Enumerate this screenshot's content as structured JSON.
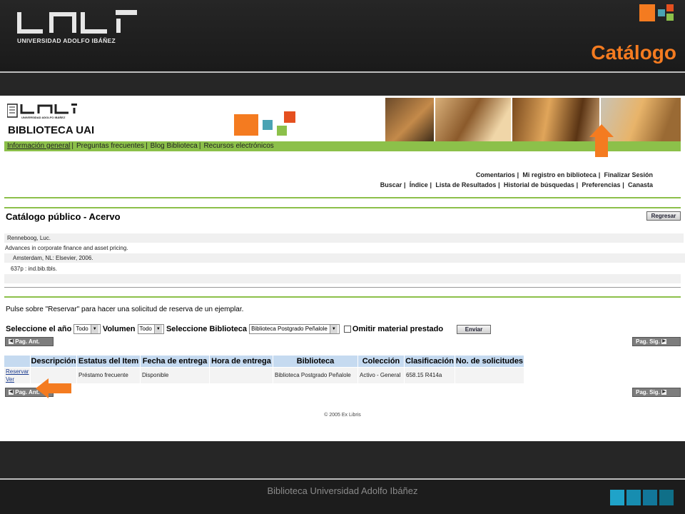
{
  "slide": {
    "logo_text": "UNIVERSIDAD ADOLFO IBÁÑEZ",
    "title": "Catálogo",
    "footer": "Biblioteca Universidad Adolfo Ibáñez",
    "colors": {
      "accent": "#f47b20",
      "green": "#8cc04a",
      "teal": "#0f6f88"
    }
  },
  "webpage": {
    "logo_small_text": "UNIVERSIDAD ADOLFO IBÁÑEZ",
    "library_title": "BIBLIOTECA UAI",
    "top_menu": [
      "Información general",
      "Preguntas frecuentes",
      "Blog Biblioteca",
      "Recursos electrónicos"
    ],
    "user_nav": [
      "Comentarios",
      "Mi registro en biblioteca",
      "Finalizar Sesión"
    ],
    "main_nav": [
      "Buscar",
      "Índice",
      "Lista de Resultados",
      "Historial de búsquedas",
      "Preferencias",
      "Canasta"
    ],
    "page_title": "Catálogo público - Acervo",
    "back_button": "Regresar",
    "record": [
      "Renneboog, Luc.",
      "Advances in corporate finance and asset pricing.",
      "Amsterdam, NL: Elsevier, 2006.",
      "637p : ind.bib.tbls."
    ],
    "instruction": "Pulse sobre \"Reservar\" para hacer una solicitud de reserva de un ejemplar.",
    "form": {
      "year_label": "Seleccione el año",
      "year_value": "Todo",
      "volume_label": "Volumen",
      "volume_value": "Todo",
      "library_label": "Seleccione Biblioteca",
      "library_value": "Biblioteca Postgrado Peñalole",
      "omit_label": "Omitir material prestado",
      "submit": "Enviar"
    },
    "prev_page": "Pag. Ant.",
    "next_page": "Pag. Sig.",
    "table": {
      "headers": [
        "Descripción",
        "Estatus del Item",
        "Fecha de entrega",
        "Hora de entrega",
        "Biblioteca",
        "Colección",
        "Clasificación",
        "No. de solicitudes"
      ],
      "links": [
        "Reservar",
        "Ver"
      ],
      "row": [
        "",
        "Préstamo frecuente",
        "Disponible",
        "",
        "Biblioteca Postgrado Peñalole",
        "Activo - General",
        "658.15 R414a",
        ""
      ]
    },
    "copyright": "© 2005 Ex Libris"
  }
}
